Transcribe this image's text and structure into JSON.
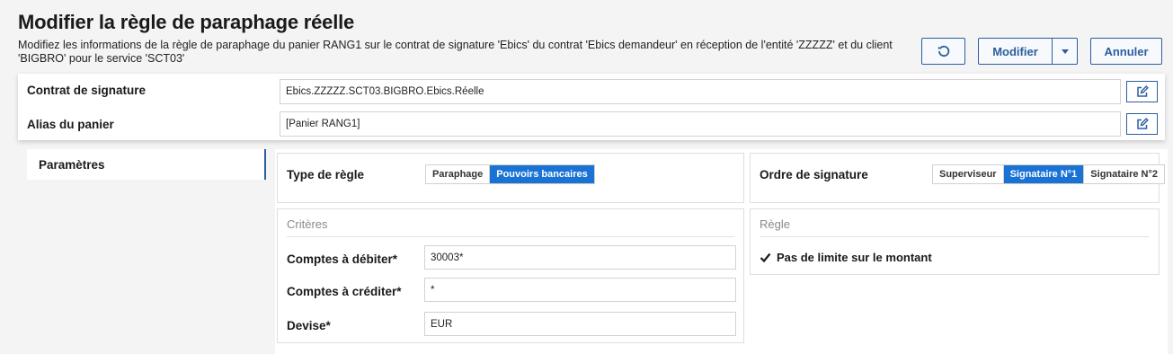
{
  "page": {
    "title": "Modifier la règle de paraphage réelle",
    "description": "Modifiez les informations de la règle de paraphage du panier RANG1 sur le contrat de signature 'Ebics' du contrat 'Ebics demandeur' en réception de l'entité 'ZZZZZ' et du client 'BIGBRO' pour le service 'SCT03'"
  },
  "toolbar": {
    "reset_icon": "refresh-icon",
    "modify_label": "Modifier",
    "dropdown_icon": "caret-down-icon",
    "cancel_label": "Annuler"
  },
  "header": {
    "contract_label": "Contrat de signature",
    "contract_value": "Ebics.ZZZZZ.SCT03.BIGBRO.Ebics.Réelle",
    "alias_label": "Alias du panier",
    "alias_value": "[Panier RANG1]"
  },
  "sidebar": {
    "items": [
      {
        "label": "Paramètres",
        "active": true
      }
    ]
  },
  "rule_type": {
    "label": "Type de règle",
    "options": [
      "Paraphage",
      "Pouvoirs bancaires"
    ],
    "selected": "Pouvoirs bancaires"
  },
  "signature_order": {
    "label": "Ordre de signature",
    "options": [
      "Superviseur",
      "Signataire N°1",
      "Signataire N°2"
    ],
    "selected": "Signataire N°1"
  },
  "criteria": {
    "title": "Critères",
    "fields": [
      {
        "label": "Comptes à débiter*",
        "value": "30003*"
      },
      {
        "label": "Comptes à créditer*",
        "value": "*"
      },
      {
        "label": "Devise*",
        "value": "EUR"
      }
    ]
  },
  "rule": {
    "title": "Règle",
    "no_limit_label": "Pas de limite sur le montant",
    "no_limit_checked": true
  },
  "colors": {
    "accent": "#2b5ea0",
    "selected_segment": "#1a73d4",
    "background": "#f4f4f4"
  }
}
